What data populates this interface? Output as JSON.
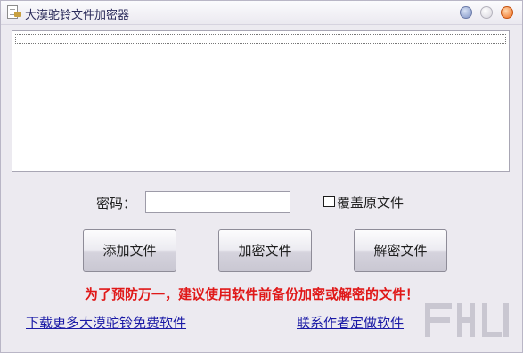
{
  "window": {
    "title": "大漠驼铃文件加密器",
    "icon": "document-icon"
  },
  "titlebar_buttons": [
    "minimize",
    "maximize",
    "close"
  ],
  "file_list": {
    "rows": []
  },
  "password": {
    "label": "密码：",
    "value": "",
    "placeholder": ""
  },
  "overwrite_checkbox": {
    "label": "覆盖原文件",
    "checked": false
  },
  "buttons": {
    "add_files": "添加文件",
    "encrypt_files": "加密文件",
    "decrypt_files": "解密文件"
  },
  "warning_text": "为了预防万一，建议使用软件前备份加密或解密的文件！",
  "links": {
    "download_more": "下载更多大漠驼铃免费软件",
    "contact_author": "联系作者定做软件"
  },
  "colors": {
    "window_bg": "#eceaf0",
    "warning": "#e01818",
    "link": "#1a1aa6"
  }
}
